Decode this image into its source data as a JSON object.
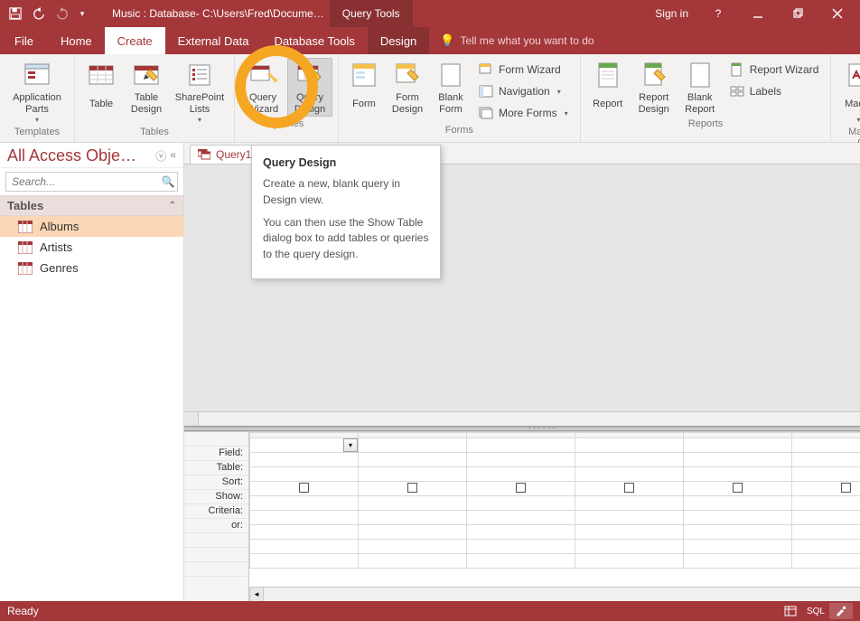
{
  "titlebar": {
    "doc_title": "Music : Database- C:\\Users\\Fred\\Docume…",
    "context_tab": "Query Tools",
    "sign_in": "Sign in"
  },
  "ribbon_tabs": {
    "file": "File",
    "home": "Home",
    "create": "Create",
    "external_data": "External Data",
    "database_tools": "Database Tools",
    "design": "Design",
    "tell_me": "Tell me what you want to do"
  },
  "ribbon": {
    "templates": {
      "app_parts": "Application\nParts",
      "group_label": "Templates"
    },
    "tables": {
      "table": "Table",
      "table_design": "Table\nDesign",
      "sharepoint_lists": "SharePoint\nLists",
      "group_label": "Tables"
    },
    "queries": {
      "query_wizard": "Query\nWizard",
      "query_design": "Query\nDesign",
      "group_label": "Queries"
    },
    "forms": {
      "form": "Form",
      "form_design": "Form\nDesign",
      "blank_form": "Blank\nForm",
      "form_wizard": "Form Wizard",
      "navigation": "Navigation",
      "more_forms": "More Forms",
      "group_label": "Forms"
    },
    "reports": {
      "report": "Report",
      "report_design": "Report\nDesign",
      "blank_report": "Blank\nReport",
      "report_wizard": "Report Wizard",
      "labels": "Labels",
      "group_label": "Reports"
    },
    "macros": {
      "macro": "Macro",
      "group_label": "Macros & Code"
    }
  },
  "tooltip": {
    "title": "Query Design",
    "p1": "Create a new, blank query in Design view.",
    "p2": "You can then use the Show Table dialog box to add tables or queries to the query design."
  },
  "nav": {
    "header": "All Access Obje…",
    "search_placeholder": "Search...",
    "section_tables": "Tables",
    "items": {
      "albums": "Albums",
      "artists": "Artists",
      "genres": "Genres"
    }
  },
  "doc": {
    "tab_label": "Query1",
    "grid_labels": {
      "field": "Field:",
      "table": "Table:",
      "sort": "Sort:",
      "show": "Show:",
      "criteria": "Criteria:",
      "or": "or:"
    }
  },
  "status": {
    "ready": "Ready",
    "sql": "SQL"
  }
}
